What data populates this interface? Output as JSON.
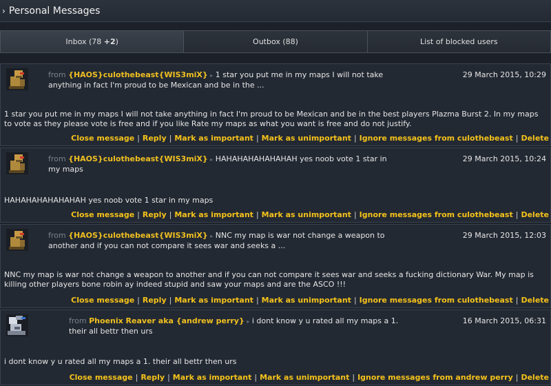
{
  "header": {
    "title": "Personal Messages"
  },
  "tabs": [
    {
      "label_main": "Inbox (78 ",
      "label_bold": "+2",
      "label_end": ")"
    },
    {
      "label": "Outbox (88)"
    },
    {
      "label": "List of blocked users"
    }
  ],
  "labels": {
    "from": "from"
  },
  "messages": [
    {
      "sender": "{HAOS}culothebeast{WIS3miX}",
      "preview": "1 star you put me in my maps I will not take anything in fact I'm proud to be Mexican and be in the ...",
      "date": "29 March 2015, 10:29",
      "body": "1 star you put me in my maps I will not take anything in fact I'm proud to be Mexican and be in the best players Plazma Burst 2. In my maps to vote as they please vote is free and if you like Rate my maps as what you want is free and do not justify.",
      "avatar": "robot-avatar",
      "actions": [
        "Close message",
        "Reply",
        "Mark as important",
        "Mark as unimportant",
        "Ignore messages from culothebeast",
        "Delete"
      ]
    },
    {
      "sender": "{HAOS}culothebeast{WIS3miX}",
      "preview": "HAHAHAHAHAHAHAH yes noob vote 1 star in my maps",
      "date": "29 March 2015, 10:24",
      "body": "HAHAHAHAHAHAHAH yes noob vote 1 star in my maps",
      "avatar": "robot-avatar",
      "actions": [
        "Close message",
        "Reply",
        "Mark as important",
        "Mark as unimportant",
        "Ignore messages from culothebeast",
        "Delete"
      ]
    },
    {
      "sender": "{HAOS}culothebeast{WIS3miX}",
      "preview": "NNC my map is war not change a weapon to another and if you can not compare it sees war and seeks a ...",
      "date": "29 March 2015, 12:03",
      "body": "NNC my map is war not change a weapon to another and if you can not compare it sees war and seeks a fucking dictionary War. My map is killing other players bone robin ay indeed stupid and saw your maps and are the ASCO !!!",
      "avatar": "robot-avatar",
      "actions": [
        "Close message",
        "Reply",
        "Mark as important",
        "Mark as unimportant",
        "Ignore messages from culothebeast",
        "Delete"
      ]
    },
    {
      "sender": "Phoenix Reaver aka {andrew perry}",
      "preview": "i dont know y u rated all my maps a 1. their all bettr then urs",
      "date": "16 March 2015, 06:31",
      "body": "i dont know y u rated all my maps a 1. their all bettr then urs",
      "avatar": "phoenix-avatar",
      "actions": [
        "Close message",
        "Reply",
        "Mark as important",
        "Mark as unimportant",
        "Ignore messages from andrew perry",
        "Delete"
      ]
    }
  ]
}
